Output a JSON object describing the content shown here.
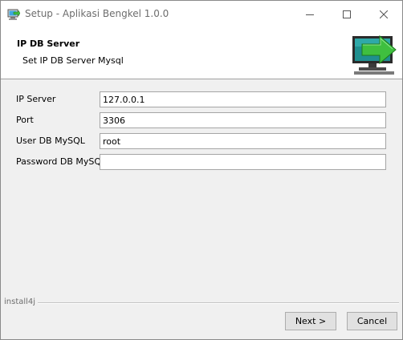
{
  "window": {
    "title": "Setup - Aplikasi Bengkel 1.0.0",
    "app_icon": "installer-icon"
  },
  "banner": {
    "title": "IP DB Server",
    "subtitle": "Set IP DB Server Mysql",
    "graphic_icon": "monitor-arrow-icon"
  },
  "form": {
    "fields": [
      {
        "label": "IP Server",
        "value": "127.0.0.1"
      },
      {
        "label": "Port",
        "value": "3306"
      },
      {
        "label": "User DB MySQL",
        "value": "root"
      },
      {
        "label": "Password DB MySQL",
        "value": ""
      }
    ]
  },
  "footer": {
    "brand": "install4j",
    "next_label": "Next >",
    "cancel_label": "Cancel"
  },
  "colors": {
    "accent_green": "#3fbf3f",
    "monitor_teal": "#1f8f8f"
  }
}
